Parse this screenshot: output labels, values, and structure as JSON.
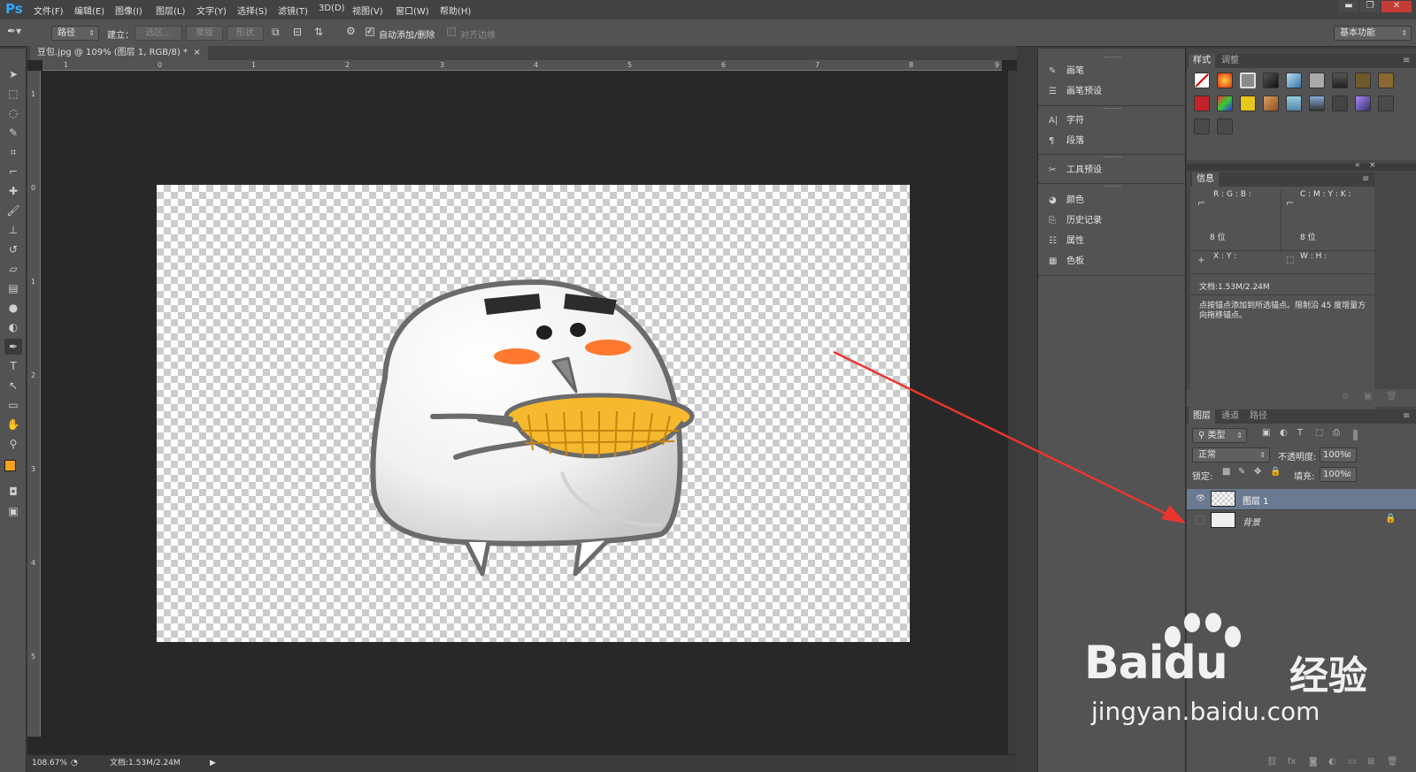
{
  "app": {
    "logo": "Ps"
  },
  "menu": [
    "文件(F)",
    "编辑(E)",
    "图像(I)",
    "图层(L)",
    "文字(Y)",
    "选择(S)",
    "滤镜(T)",
    "3D(D)",
    "视图(V)",
    "窗口(W)",
    "帮助(H)"
  ],
  "options_bar": {
    "tool_mode": "路径",
    "make_label": "建立：",
    "btn_selection": "选区...",
    "btn_mask": "蒙版",
    "btn_shape": "形状",
    "auto_add_delete": "自动添加/删除",
    "align_edges": "对齐边缘",
    "workspace": "基本功能"
  },
  "document": {
    "tab_title": "豆包.jpg @ 109% (图层 1, RGB/8) *",
    "ruler_top": [
      "1",
      "0",
      "1",
      "2",
      "3",
      "4",
      "5",
      "6",
      "7",
      "8",
      "9"
    ],
    "ruler_left": [
      "1",
      "0",
      "1",
      "2",
      "3",
      "4",
      "5"
    ]
  },
  "status": {
    "zoom": "108.67%",
    "doc": "文档:1.53M/2.24M"
  },
  "mid_panel": {
    "items": [
      {
        "label": "画笔",
        "icon": "brush-icon"
      },
      {
        "label": "画笔预设",
        "icon": "brush-preset-icon"
      },
      {
        "label": "字符",
        "icon": "character-icon"
      },
      {
        "label": "段落",
        "icon": "paragraph-icon"
      },
      {
        "label": "工具预设",
        "icon": "tool-preset-icon"
      },
      {
        "label": "颜色",
        "icon": "color-icon"
      },
      {
        "label": "历史记录",
        "icon": "history-icon"
      },
      {
        "label": "属性",
        "icon": "properties-icon"
      },
      {
        "label": "色板",
        "icon": "swatches-icon"
      }
    ]
  },
  "styles_panel": {
    "tabs": [
      "样式",
      "调整"
    ]
  },
  "info_panel": {
    "tab": "信息",
    "rgb_labels": "R :\nG :\nB :",
    "cmyk_labels": "C :\nM :\nY :\nK :",
    "bit1": "8 位",
    "bit2": "8 位",
    "xy": "X :\nY :",
    "wh": "W :\nH :",
    "doc": "文档:1.53M/2.24M",
    "hint": "点按锚点添加到所选锚点。限制沿 45 度增量方向拖移锚点。"
  },
  "layers_panel": {
    "tabs": [
      "图层",
      "通道",
      "路径"
    ],
    "filter": "类型",
    "blend_mode": "正常",
    "opacity_label": "不透明度:",
    "opacity": "100%",
    "lock_label": "锁定:",
    "fill_label": "填充:",
    "fill": "100%",
    "layers": [
      {
        "name": "图层 1",
        "selected": true,
        "visible": true
      },
      {
        "name": "背景",
        "selected": false,
        "visible": false,
        "locked": true
      }
    ]
  },
  "watermark": {
    "brand": "Bai",
    "brand2": "du",
    "cn": "经验",
    "url": "jingyan.baidu.com"
  },
  "colors": {
    "foreground": "#f5a21b",
    "background": "#ffffff",
    "arrow": "#e8362f"
  }
}
